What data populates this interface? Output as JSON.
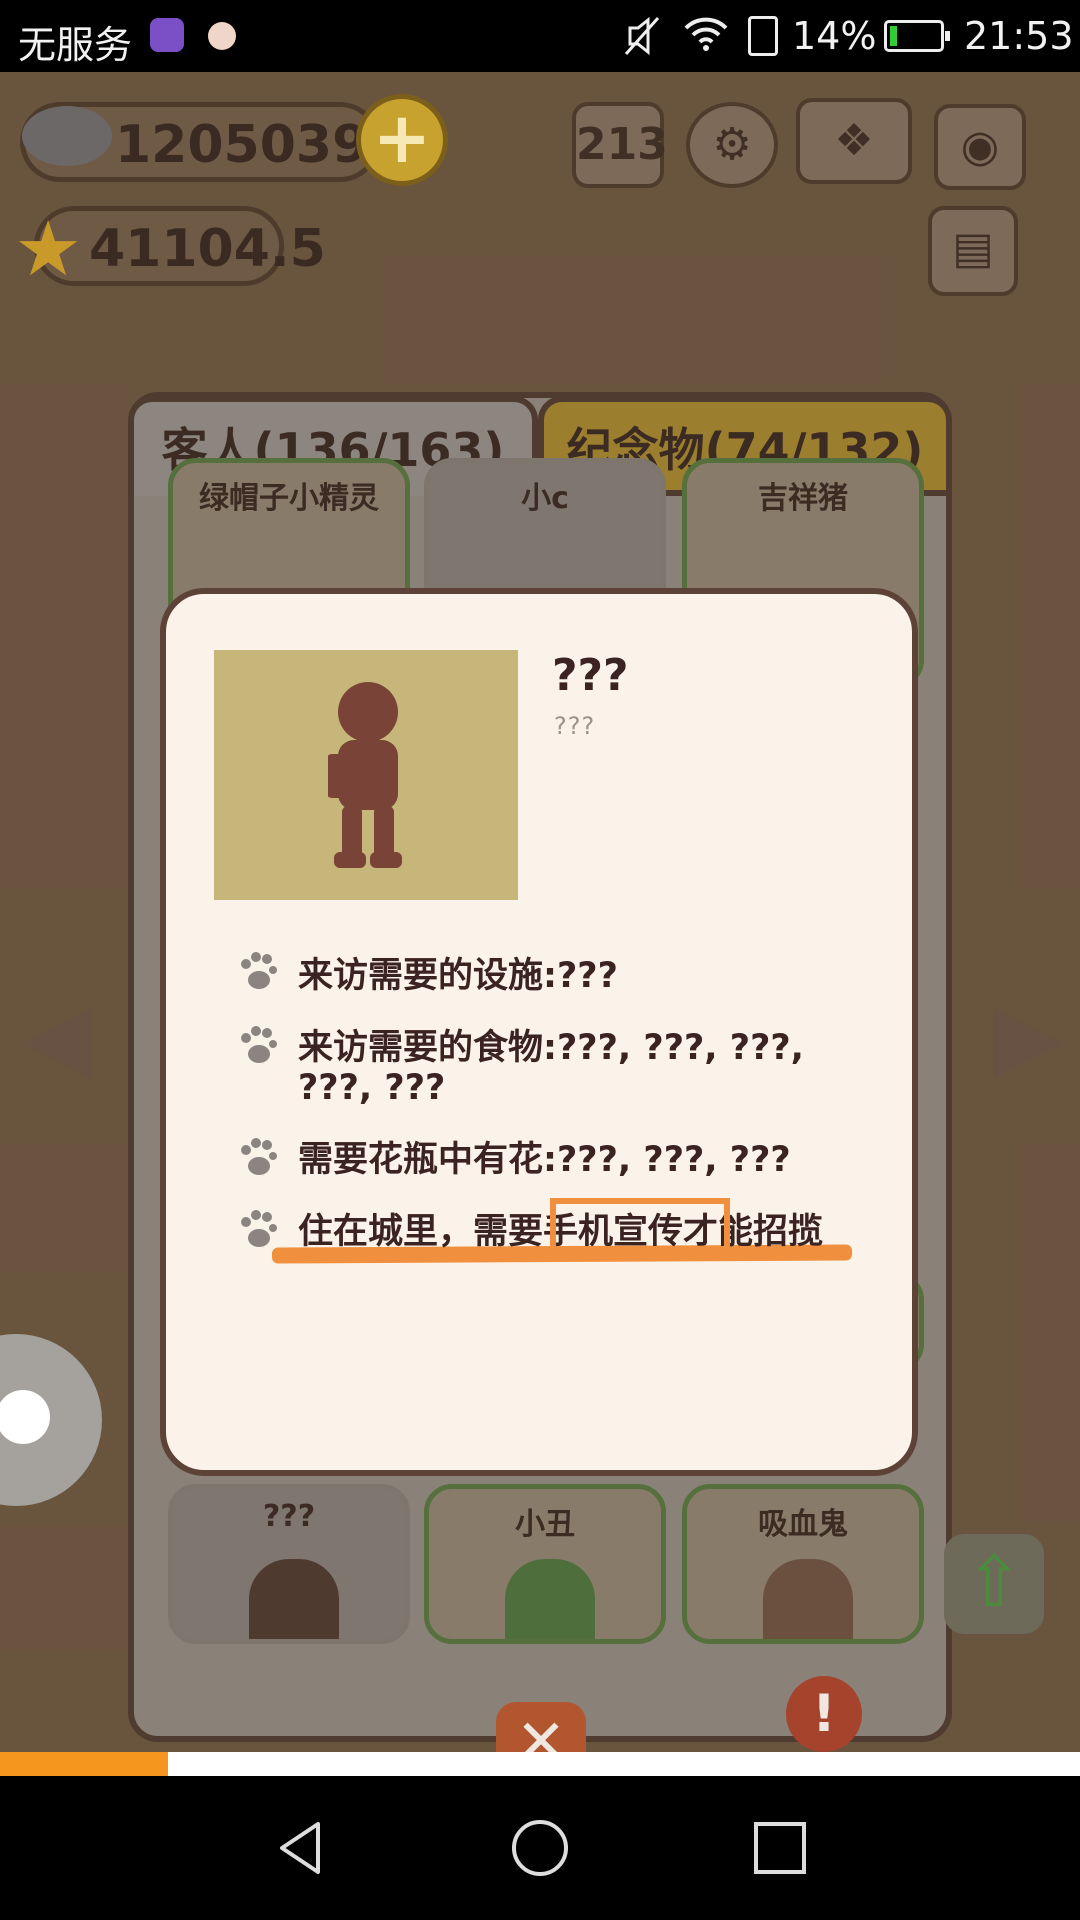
{
  "status_bar": {
    "carrier": "无服务",
    "battery_percent": "14%",
    "battery_level": 0.14,
    "time": "21:53"
  },
  "hud": {
    "fish_count": "12050396",
    "star_count": "41104.5",
    "icons": [
      "fish-icon",
      "plus-icon",
      "rank-icon",
      "gear-icon",
      "book-icon",
      "camera-icon",
      "card-icon",
      "star-icon"
    ]
  },
  "collection_panel": {
    "tabs": [
      {
        "label": "客人(136/163)",
        "active": true
      },
      {
        "label": "纪念物(74/132)",
        "active": false
      }
    ],
    "guest_cards_top": [
      {
        "name": "绿帽子小精灵"
      },
      {
        "name": "小c"
      },
      {
        "name": "吉祥猪"
      }
    ],
    "guest_cards_bottom": [
      {
        "name": "???"
      },
      {
        "name": "小丑"
      },
      {
        "name": "吸血鬼"
      }
    ]
  },
  "guest_detail": {
    "name": "???",
    "subtitle": "???",
    "requirements": [
      "来访需要的设施:???",
      "来访需要的食物:???, ???, ???, ???, ???",
      "需要花瓶中有花:???, ???, ???",
      "住在城里，需要手机宣传才能招揽"
    ]
  },
  "colors": {
    "dialog_bg": "#fbf3ea",
    "dialog_border": "#5d4337",
    "highlight": "#f0903e",
    "tab_active": "#8d8580",
    "tab_inactive": "#9b7f2f"
  }
}
